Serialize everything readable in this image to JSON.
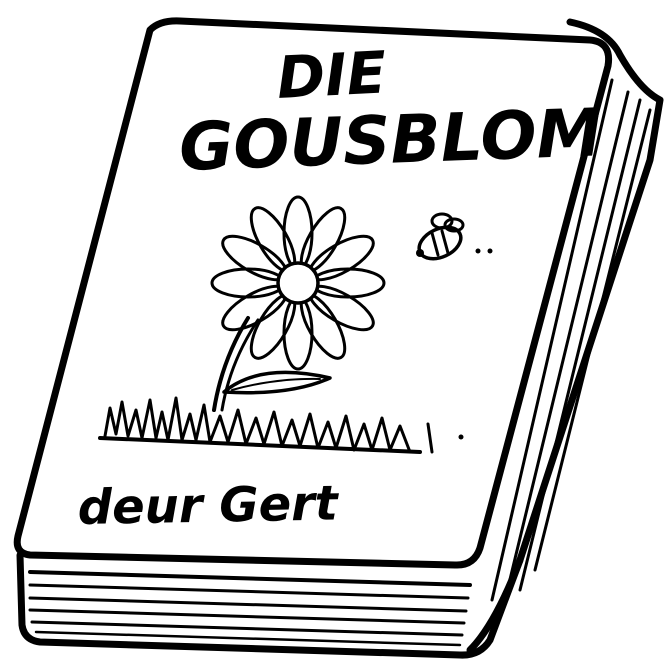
{
  "book": {
    "title_line1": "DIE",
    "title_line2": "GOUSBLOM",
    "author": "deur Gert"
  },
  "colors": {
    "ink": "#000000",
    "paper": "#ffffff"
  },
  "icons": [
    "daisy-flower-icon",
    "bee-icon",
    "grass-icon"
  ]
}
